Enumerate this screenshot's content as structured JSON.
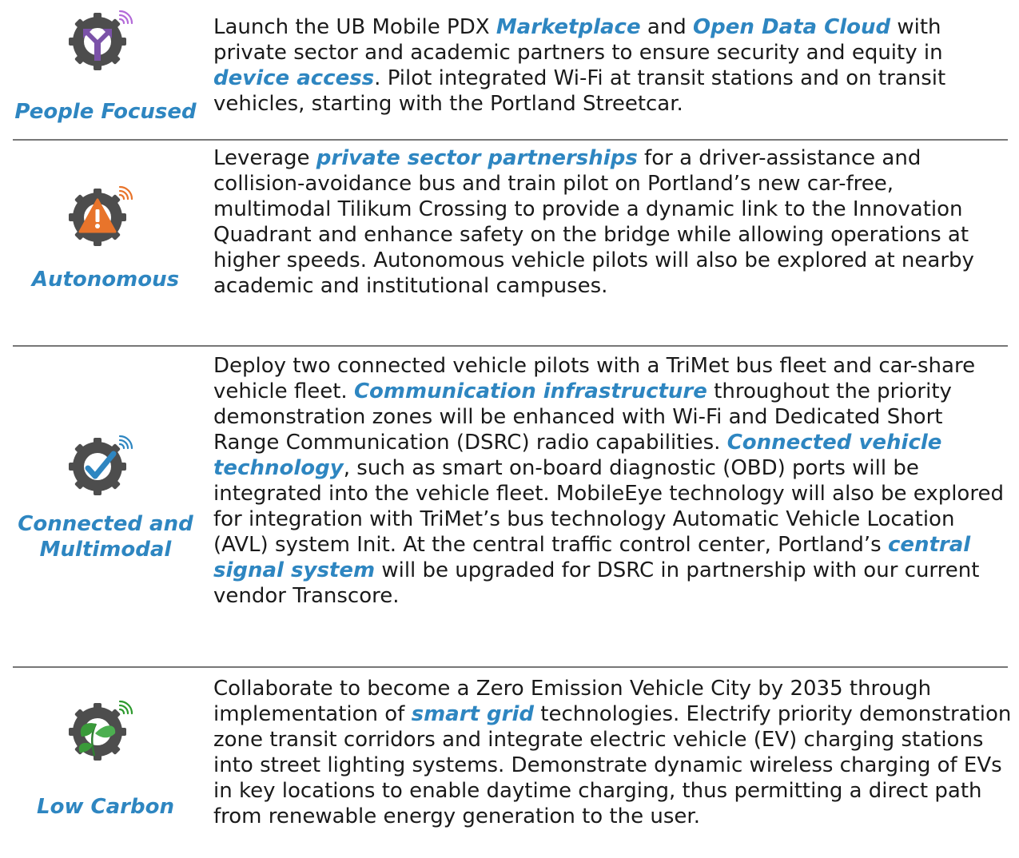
{
  "colors": {
    "accent": "#2e86c1",
    "tire": "#4d4d4d",
    "purple": "#7b52a8",
    "orange": "#e8742b",
    "check_blue": "#2e86c1",
    "leaf_green": "#3a9a3a",
    "wifi_green": "#2e9a2e",
    "wifi_orange": "#e8742b",
    "wifi_blue": "#2e86c1",
    "wifi_purple": "#b36ad8",
    "rule": "#777777"
  },
  "rows": [
    {
      "label": "People Focused",
      "icon": "people-focused-tire-icon",
      "text": [
        "Launch the UB Mobile PDX ",
        {
          "hl": "Marketplace"
        },
        " and ",
        {
          "hl": "Open Data Cloud"
        },
        " with private sector and academic partners to ensure security and equity in ",
        {
          "hl": "device access"
        },
        ". Pilot integrated Wi-Fi at transit stations and on transit vehicles, starting with the Portland Streetcar."
      ]
    },
    {
      "label": "Autonomous",
      "icon": "autonomous-warning-tire-icon",
      "text": [
        "Leverage ",
        {
          "hl": "private sector partnerships"
        },
        " for a driver-assistance and collision-avoidance bus and train pilot on Portland’s new car-free, multimodal Tilikum Crossing to provide a dynamic link to the Innovation Quadrant and enhance safety on the bridge while allowing operations at higher speeds. Autonomous vehicle pilots will also be explored at nearby academic and institutional campuses."
      ]
    },
    {
      "label": "Connected and Multimodal",
      "icon": "connected-check-tire-icon",
      "text": [
        "Deploy two connected vehicle pilots with a TriMet bus fleet and car-share vehicle fleet. ",
        {
          "hl": "Communication infrastructure"
        },
        " throughout the priority demonstration zones will be enhanced with Wi-Fi and Dedicated Short Range Communication (DSRC) radio capabilities. ",
        {
          "hl": "Connected vehicle technology"
        },
        ", such as smart on-board diagnostic (OBD) ports will be integrated into the vehicle fleet. MobileEye technology will also be explored for integration with TriMet’s bus technology Automatic Vehicle Location (AVL) system Init. At the central traffic control center, Portland’s ",
        {
          "hl": "central signal system"
        },
        " will be upgraded for DSRC in partnership with our current vendor Transcore."
      ]
    },
    {
      "label": "Low Carbon",
      "icon": "low-carbon-leaf-tire-icon",
      "text": [
        "Collaborate to become a Zero Emission Vehicle City by 2035 through implementation of ",
        {
          "hl": "smart grid"
        },
        " technologies. Electrify priority demonstration zone transit corridors and integrate electric vehicle (EV) charging stations into street lighting systems. Demonstrate dynamic wireless charging of EVs in key locations to enable daytime charging, thus permitting a direct path from renewable energy generation to the user."
      ]
    }
  ]
}
